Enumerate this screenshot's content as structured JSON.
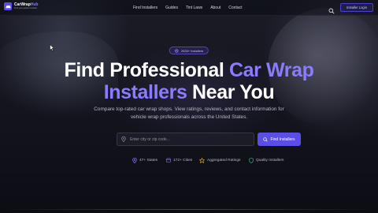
{
  "header": {
    "logo": {
      "name_part1": "CarWrap",
      "name_part2": "Hub",
      "tagline": "Find your perfect installer"
    },
    "nav": [
      "Find Installers",
      "Guides",
      "Tint Laws",
      "About",
      "Contact"
    ],
    "login_label": "Installer Login"
  },
  "hero": {
    "badge": "2026+ Installers",
    "title_line1_a": "Find Professional ",
    "title_line1_b": "Car Wrap",
    "title_line2_a": "Installers",
    "title_line2_b": " Near You",
    "subtitle": "Compare top-rated car wrap shops. View ratings, reviews, and contact information for vehicle wrap professionals across the United States.",
    "search": {
      "placeholder": "Enter city or zip code...",
      "value": "",
      "button_label": "Find Installers"
    },
    "features": [
      {
        "icon": "map-pin-icon",
        "label": "47+ States"
      },
      {
        "icon": "building-icon",
        "label": "172+ Cities"
      },
      {
        "icon": "star-icon",
        "label": "Aggregated Ratings"
      },
      {
        "icon": "shield-icon",
        "label": "Quality Installers"
      }
    ]
  },
  "colors": {
    "accent": "#8b7bff",
    "button": "#5b4ee8",
    "star": "#f0b429",
    "shield": "#39c98a"
  }
}
